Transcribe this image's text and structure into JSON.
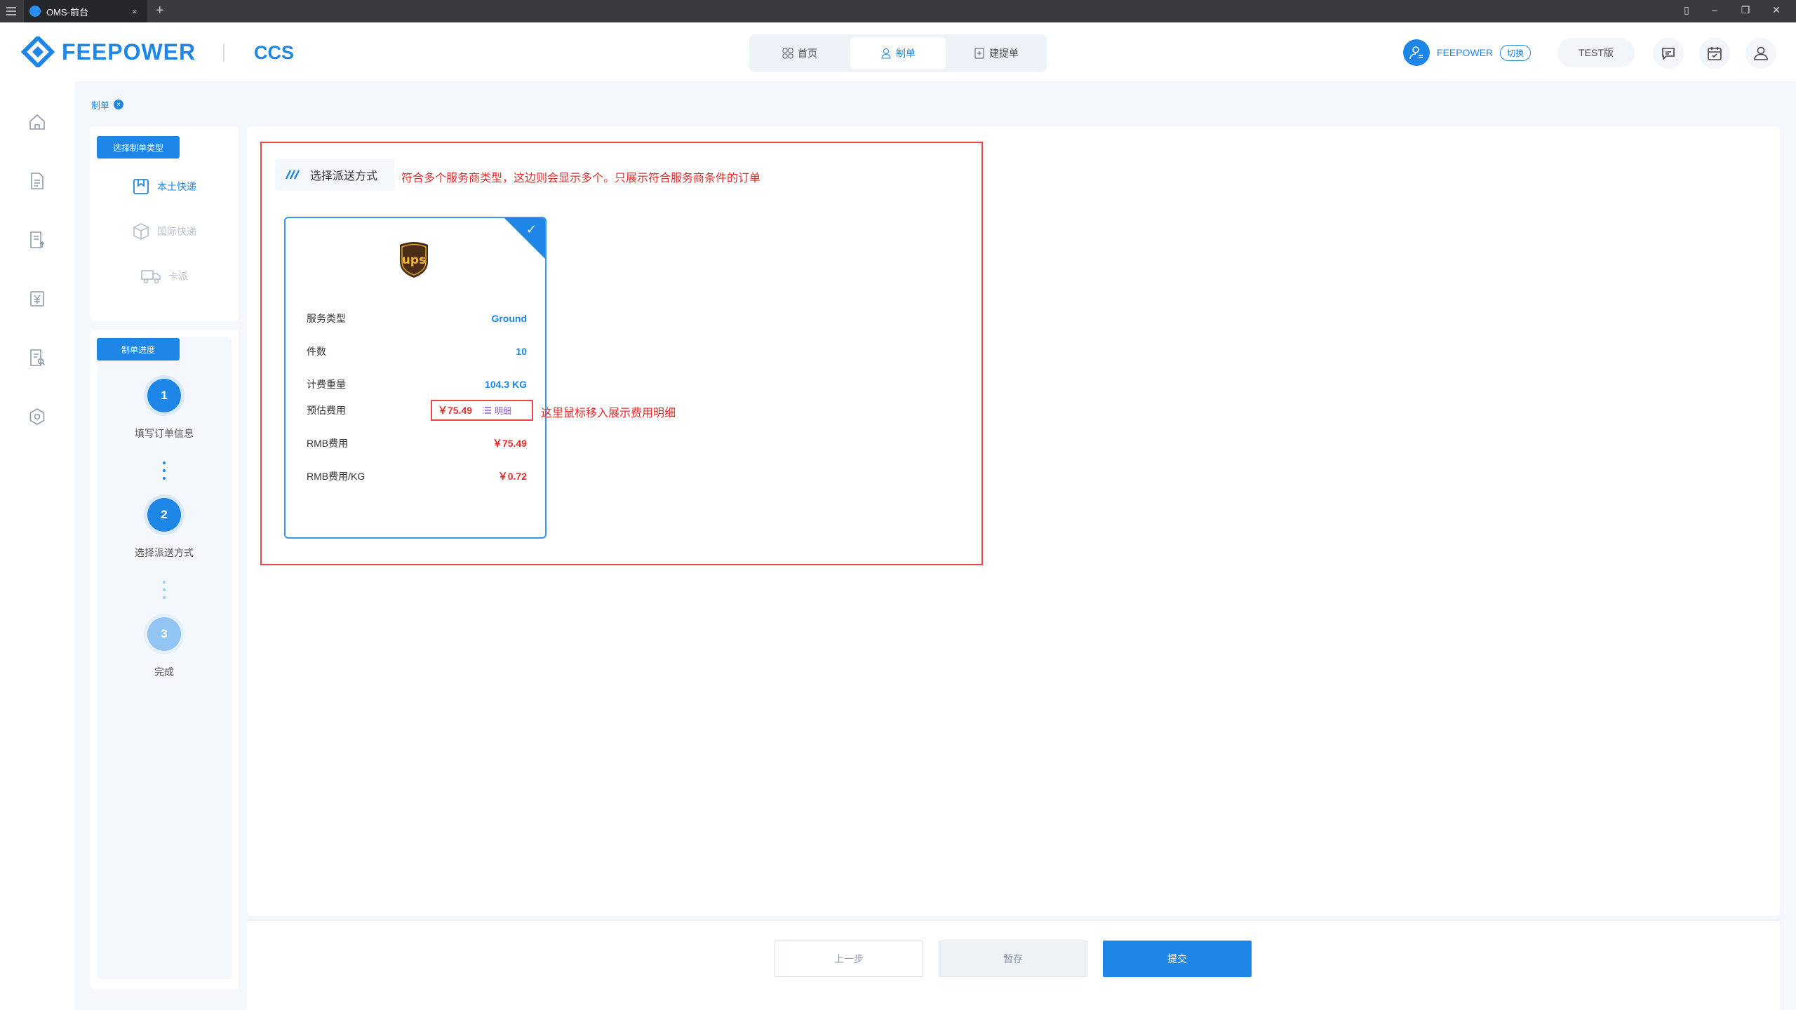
{
  "browser": {
    "tab_title": "OMS-前台",
    "new_tab": "+",
    "tab_close": "×"
  },
  "header": {
    "brand": "FEEPOWER",
    "product": "CCS",
    "nav": [
      {
        "label": "首页",
        "icon": "grid-icon",
        "active": false
      },
      {
        "label": "制单",
        "icon": "user-form-icon",
        "active": true
      },
      {
        "label": "建提单",
        "icon": "add-document-icon",
        "active": false
      }
    ],
    "user_name": "FEEPOWER",
    "switch_label": "切换",
    "edition": "TEST版"
  },
  "breadcrumb": {
    "label": "制单",
    "close": "×"
  },
  "sidebar": {
    "type_section_title": "选择制单类型",
    "types": [
      {
        "label": "本土快递",
        "active": true
      },
      {
        "label": "国际快递",
        "active": false
      },
      {
        "label": "卡派",
        "active": false
      }
    ],
    "progress_title": "制单进度",
    "steps": [
      {
        "num": "1",
        "label": "填写订单信息",
        "state": "done"
      },
      {
        "num": "2",
        "label": "选择派送方式",
        "state": "done"
      },
      {
        "num": "3",
        "label": "完成",
        "state": "todo"
      }
    ]
  },
  "main": {
    "section_title": "选择派送方式",
    "note_top": "符合多个服务商类型，这边则会显示多个。只展示符合服务商条件的订单",
    "note_fee": "这里鼠标移入展示费用明细",
    "card": {
      "carrier_logo": "ups",
      "selected": true,
      "rows": [
        {
          "label": "服务类型",
          "value": "Ground"
        },
        {
          "label": "件数",
          "value": "10"
        },
        {
          "label": "计费重量",
          "value": "104.3 KG"
        },
        {
          "label": "预估费用",
          "value": "￥75.49",
          "detail": "明细"
        },
        {
          "label": "RMB费用",
          "value": "￥75.49"
        },
        {
          "label": "RMB费用/KG",
          "value": "￥0.72"
        }
      ]
    }
  },
  "footer": {
    "prev": "上一步",
    "save": "暂存",
    "submit": "提交"
  },
  "colors": {
    "primary": "#1e86e6",
    "annotation_red": "#e62b2b",
    "detail_purple": "#8a55e6"
  }
}
